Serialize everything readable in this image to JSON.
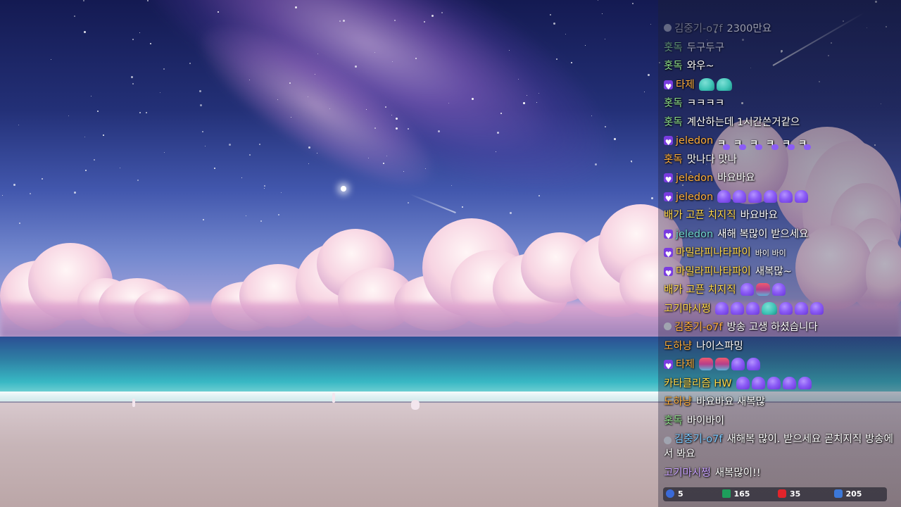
{
  "colors": {
    "nick_gray": "#a8aab2",
    "nick_green": "#8fe08a",
    "nick_orange": "#ffae3b",
    "nick_teal": "#6fd6d0",
    "nick_pink": "#ff9fd6",
    "nick_blue": "#78c8ff",
    "nick_yellow": "#ffd84a",
    "nick_purple": "#c9a2ff",
    "badge_purple": "#7a3ce0"
  },
  "chat": {
    "messages": [
      {
        "badge": "user-icon",
        "nick": "김중기-o7f",
        "nick_color": "#a8aab2",
        "text": "2300만요",
        "faded": true
      },
      {
        "nick": "홋독",
        "nick_color": "#8fe08a",
        "text": "두구두구",
        "faded": true
      },
      {
        "nick": "홋독",
        "nick_color": "#8fe08a",
        "text": "와우~"
      },
      {
        "badge": "subscriber-heart-icon",
        "nick": "타제",
        "nick_color": "#ffae3b",
        "text": "",
        "emotes": [
          "teal",
          "teal"
        ]
      },
      {
        "nick": "홋독",
        "nick_color": "#8fe08a",
        "text": "ㅋㅋㅋㅋ"
      },
      {
        "nick": "홋독",
        "nick_color": "#8fe08a",
        "text": "계산하는데 1시간쓴거같으"
      },
      {
        "badge": "subscriber-heart-icon",
        "nick": "jeledon",
        "nick_color": "#ffae3b",
        "text": "",
        "emotes": [
          "kk",
          "kk",
          "kk",
          "kk",
          "kk",
          "kk"
        ]
      },
      {
        "nick": "홋독",
        "nick_color": "#ffae3b",
        "text": "맛나다 맛나"
      },
      {
        "badge": "subscriber-heart-icon",
        "nick": "jeledon",
        "nick_color": "#ffae3b",
        "text": "바요바요"
      },
      {
        "badge": "subscriber-heart-icon",
        "nick": "jeledon",
        "nick_color": "#ffae3b",
        "text": "",
        "emotes": [
          "purple",
          "purple",
          "purple",
          "purple",
          "purple",
          "purple"
        ]
      },
      {
        "nick": "배가 고픈 치지직",
        "nick_color": "#ffd84a",
        "text": "바요바요"
      },
      {
        "badge": "subscriber-heart-icon",
        "nick": "jeledon",
        "nick_color": "#6fd6d0",
        "text": "새해 복많이 받으세요"
      },
      {
        "badge": "subscriber-heart-icon",
        "nick": "마밀라피나타파이",
        "nick_color": "#ffd84a",
        "text": "바이 바이",
        "small": true
      },
      {
        "badge": "subscriber-heart-icon",
        "nick": "마밀라피나타파이",
        "nick_color": "#ffd84a",
        "text": "새복많~"
      },
      {
        "nick": "배가 고픈 치지직",
        "nick_color": "#ffd84a",
        "text": "",
        "emotes": [
          "purple",
          "red",
          "purple"
        ]
      },
      {
        "nick": "고기마시쩡",
        "nick_color": "#ffd84a",
        "text": "",
        "emotes": [
          "purple",
          "purple",
          "purple",
          "teal",
          "purple",
          "purple",
          "purple"
        ]
      },
      {
        "badge": "user-icon",
        "nick": "김중기-o7f",
        "nick_color": "#ffae3b",
        "text": "방송 고생 하셨습니다"
      },
      {
        "nick": "도하냥",
        "nick_color": "#ffae3b",
        "text": "나이스파밍"
      },
      {
        "badge": "subscriber-heart-icon",
        "nick": "타제",
        "nick_color": "#ffae3b",
        "text": "",
        "emotes": [
          "red",
          "red",
          "purple",
          "purple"
        ]
      },
      {
        "nick": "카타클리즘 HW",
        "nick_color": "#ffd84a",
        "text": "",
        "emotes": [
          "purple",
          "purple",
          "purple",
          "purple",
          "purple"
        ]
      },
      {
        "nick": "도하냥",
        "nick_color": "#ffae3b",
        "text": "바요바요 새복많"
      },
      {
        "nick": "홋독",
        "nick_color": "#8fe08a",
        "text": "바이바이"
      },
      {
        "badge": "user-icon",
        "nick": "김중기-o7f",
        "nick_color": "#78c8ff",
        "text": "새해복 많이. 받으세요 곧치지직 방송에서 봐요",
        "tall": true
      },
      {
        "nick": "고기마시쩡",
        "nick_color": "#c9a2ff",
        "text": "새복많이!!"
      }
    ]
  },
  "stats": {
    "items": [
      {
        "icon": "infinity-icon",
        "value": "5"
      },
      {
        "icon": "level-icon",
        "value": "165"
      },
      {
        "icon": "youtube-icon",
        "value": "35"
      },
      {
        "icon": "lv-badge-icon",
        "value": "205"
      }
    ]
  }
}
